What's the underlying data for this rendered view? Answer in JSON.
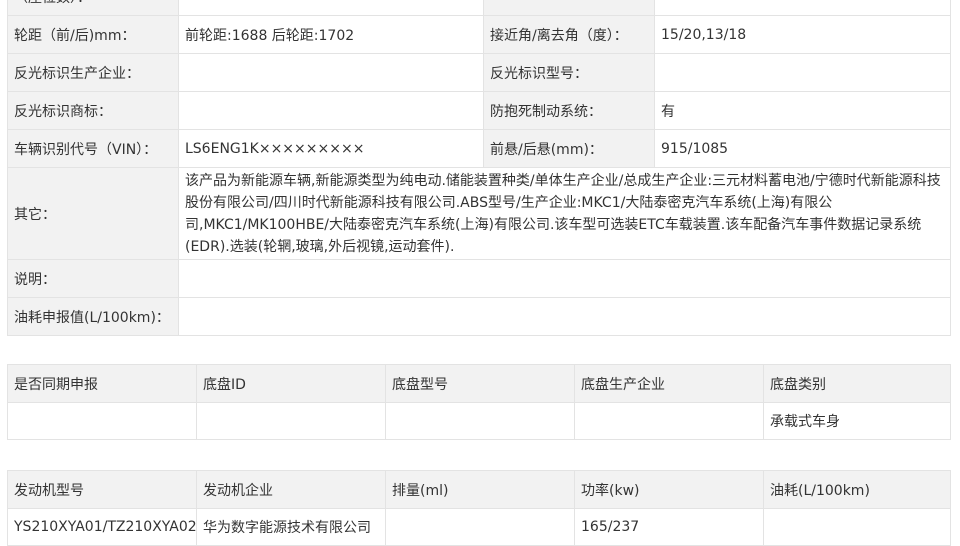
{
  "params": [
    {
      "l1": "（座位数）：",
      "v1": "",
      "l2": "",
      "v2": ""
    },
    {
      "l1": "轮距（前/后)mm：",
      "v1": "前轮距:1688 后轮距:1702",
      "l2": "接近角/离去角（度）：",
      "v2": "15/20,13/18"
    },
    {
      "l1": "反光标识生产企业：",
      "v1": "",
      "l2": "反光标识型号：",
      "v2": ""
    },
    {
      "l1": "反光标识商标：",
      "v1": "",
      "l2": "防抱死制动系统：",
      "v2": "有"
    },
    {
      "l1": "车辆识别代号（VIN）：",
      "v1": "LS6ENG1K×××××××××",
      "l2": "前悬/后悬(mm)：",
      "v2": "915/1085"
    }
  ],
  "other": {
    "label": "其它：",
    "text": "该产品为新能源车辆,新能源类型为纯电动.储能装置种类/单体生产企业/总成生产企业:三元材料蓄电池/宁德时代新能源科技股份有限公司/四川时代新能源科技有限公司.ABS型号/生产企业:MKC1/大陆泰密克汽车系统(上海)有限公司,MKC1/MK100HBE/大陆泰密克汽车系统(上海)有限公司.该车型可选装ETC车载装置.该车配备汽车事件数据记录系统(EDR).选装(轮辋,玻璃,外后视镜,运动套件)."
  },
  "note": {
    "label": "说明：",
    "value": ""
  },
  "fuel": {
    "label": "油耗申报值(L/100km)：",
    "value": ""
  },
  "chassis": {
    "headers": [
      "是否同期申报",
      "底盘ID",
      "底盘型号",
      "底盘生产企业",
      "底盘类别"
    ],
    "row": [
      "",
      "",
      "",
      "",
      "承载式车身"
    ]
  },
  "engine": {
    "headers": [
      "发动机型号",
      "发动机企业",
      "排量(ml)",
      "功率(kw)",
      "油耗(L/100km)"
    ],
    "row": [
      "YS210XYA01/TZ210XYA02",
      "华为数字能源技术有限公司",
      "",
      "165/237",
      ""
    ]
  }
}
